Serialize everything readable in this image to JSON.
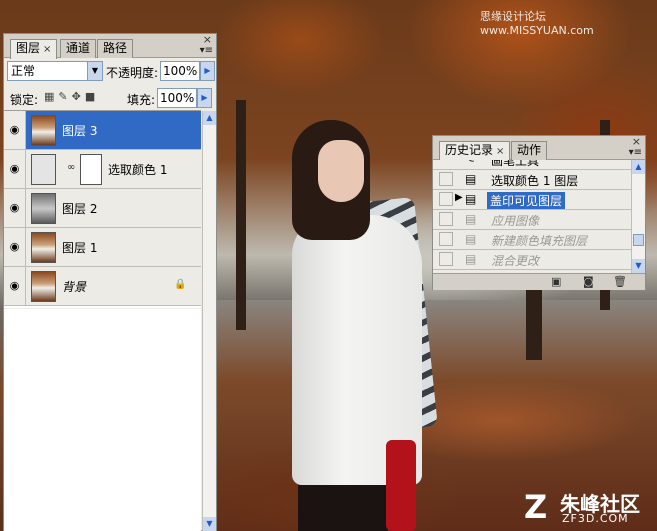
{
  "watermark": "思缘设计论坛 www.MISSYUAN.com",
  "brand": {
    "name": "朱峰社区",
    "url": "ZF3D.COM",
    "logo_glyph": "Z"
  },
  "layers_panel": {
    "tabs": [
      {
        "label": "图层",
        "close": "×"
      },
      {
        "label": "通道"
      },
      {
        "label": "路径"
      }
    ],
    "close_glyph": "×",
    "menu_glyph": "▾≡",
    "blend_mode": "正常",
    "opacity_label": "不透明度:",
    "opacity_value": "100%",
    "lock_label": "锁定:",
    "fill_label": "填充:",
    "fill_value": "100%",
    "layers": [
      {
        "name": "图层 3",
        "thumb": "photo",
        "selected": true
      },
      {
        "name": "选取颜色 1",
        "thumb": "adjustment",
        "has_mask": true,
        "selected": false
      },
      {
        "name": "图层 2",
        "thumb": "gray",
        "selected": false
      },
      {
        "name": "图层 1",
        "thumb": "photo",
        "selected": false
      },
      {
        "name": "背景",
        "thumb": "photo",
        "locked": true,
        "selected": false
      }
    ]
  },
  "history_panel": {
    "tabs": [
      {
        "label": "历史记录",
        "close": "×"
      },
      {
        "label": "动作"
      }
    ],
    "close_glyph": "×",
    "menu_glyph": "▾≡",
    "items": [
      {
        "label": "画笔工具",
        "state": "partial"
      },
      {
        "label": "选取颜色 1 图层",
        "state": "normal"
      },
      {
        "label": "盖印可见图层",
        "state": "selected"
      },
      {
        "label": "应用图像",
        "state": "dimmed"
      },
      {
        "label": "新建颜色填充图层",
        "state": "dimmed"
      },
      {
        "label": "混合更改",
        "state": "dimmed"
      }
    ]
  }
}
